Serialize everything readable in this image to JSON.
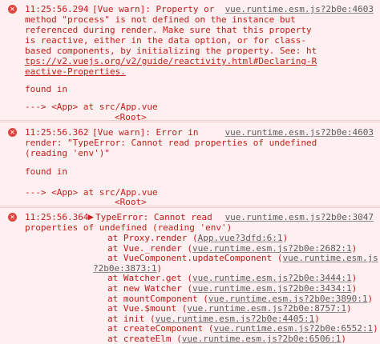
{
  "entries": [
    {
      "timestamp": "11:25:56.294",
      "source_link": "vue.runtime.esm.js?2b0e:4603",
      "message_lines": [
        "[Vue warn]: Property or",
        "method \"process\" is not defined on the instance but",
        "referenced during render. Make sure that this property",
        "is reactive, either in the data option, or for class-",
        "based components, by initializing the property. See: ht",
        "tps://v2.vuejs.org/v2/guide/reactivity.html#Declaring-R",
        "eactive-Properties."
      ],
      "found_in": "found in",
      "trace_line1": "---> <App> at src/App.vue",
      "trace_line2": "<Root>"
    },
    {
      "timestamp": "11:25:56.362",
      "source_link": "vue.runtime.esm.js?2b0e:4603",
      "message_lines": [
        "[Vue warn]: Error in",
        "render: \"TypeError: Cannot read properties of undefined",
        "(reading 'env')\""
      ],
      "found_in": "found in",
      "trace_line1": "---> <App> at src/App.vue",
      "trace_line2": "<Root>"
    },
    {
      "timestamp": "11:25:56.364",
      "source_link": "vue.runtime.esm.js?2b0e:3047",
      "expand_arrow": "▶",
      "message_lines": [
        "TypeError: Cannot read",
        "properties of undefined (reading 'env')"
      ],
      "stack": [
        {
          "prefix": "at Proxy.render (",
          "link": "App.vue?3dfd:6:1",
          "suffix": ")"
        },
        {
          "prefix": "at Vue._render (",
          "link": "vue.runtime.esm.js?2b0e:2682:1",
          "suffix": ")"
        },
        {
          "prefix": "at VueComponent.updateComponent (",
          "link": "vue.runtime.esm.js",
          "suffix": ""
        },
        {
          "prefix": "",
          "link": "?2b0e:3873:1",
          "suffix": ")"
        },
        {
          "prefix": "at Watcher.get (",
          "link": "vue.runtime.esm.js?2b0e:3444:1",
          "suffix": ")"
        },
        {
          "prefix": "at new Watcher (",
          "link": "vue.runtime.esm.js?2b0e:3434:1",
          "suffix": ")"
        },
        {
          "prefix": "at mountComponent (",
          "link": "vue.runtime.esm.js?2b0e:3890:1",
          "suffix": ")"
        },
        {
          "prefix": "at Vue.$mount (",
          "link": "vue.runtime.esm.js?2b0e:8757:1",
          "suffix": ")"
        },
        {
          "prefix": "at init (",
          "link": "vue.runtime.esm.js?2b0e:4405:1",
          "suffix": ")"
        },
        {
          "prefix": "at createComponent (",
          "link": "vue.runtime.esm.js?2b0e:6552:1",
          "suffix": ")"
        },
        {
          "prefix": "at createElm (",
          "link": "vue.runtime.esm.js?2b0e:6506:1",
          "suffix": ")"
        }
      ]
    }
  ],
  "icons": {
    "error": "error-circle-icon",
    "expand": "triangle-right-icon"
  },
  "colors": {
    "background": "#fef0f0",
    "error_text": "#c2201a",
    "link": "#5b5b5b",
    "icon": "#e0443e"
  }
}
